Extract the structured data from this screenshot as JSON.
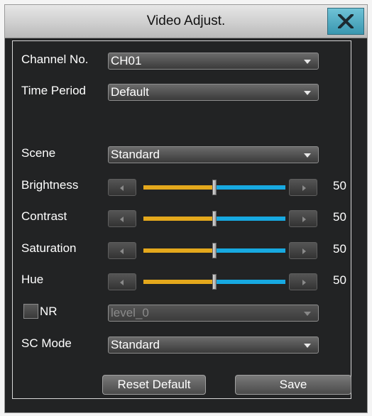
{
  "window": {
    "title": "Video Adjust.",
    "close_icon": "close-x-icon"
  },
  "fields": {
    "channel": {
      "label": "Channel No.",
      "value": "CH01"
    },
    "time_period": {
      "label": "Time Period",
      "value": "Default"
    },
    "scene": {
      "label": "Scene",
      "value": "Standard"
    },
    "nr": {
      "label": "NR",
      "checked": false,
      "value": "level_0"
    },
    "sc_mode": {
      "label": "SC Mode",
      "value": "Standard"
    }
  },
  "sliders": [
    {
      "label": "Brightness",
      "value": "50",
      "level": 0.5
    },
    {
      "label": "Contrast",
      "value": "50",
      "level": 0.5
    },
    {
      "label": "Saturation",
      "value": "50",
      "level": 0.5
    },
    {
      "label": "Hue",
      "value": "50",
      "level": 0.5
    }
  ],
  "buttons": {
    "reset": "Reset Default",
    "save": "Save"
  },
  "colors": {
    "track_fill": "#e4a81c",
    "track_rest": "#17a9e1",
    "close_button": "#4aa8c0"
  }
}
